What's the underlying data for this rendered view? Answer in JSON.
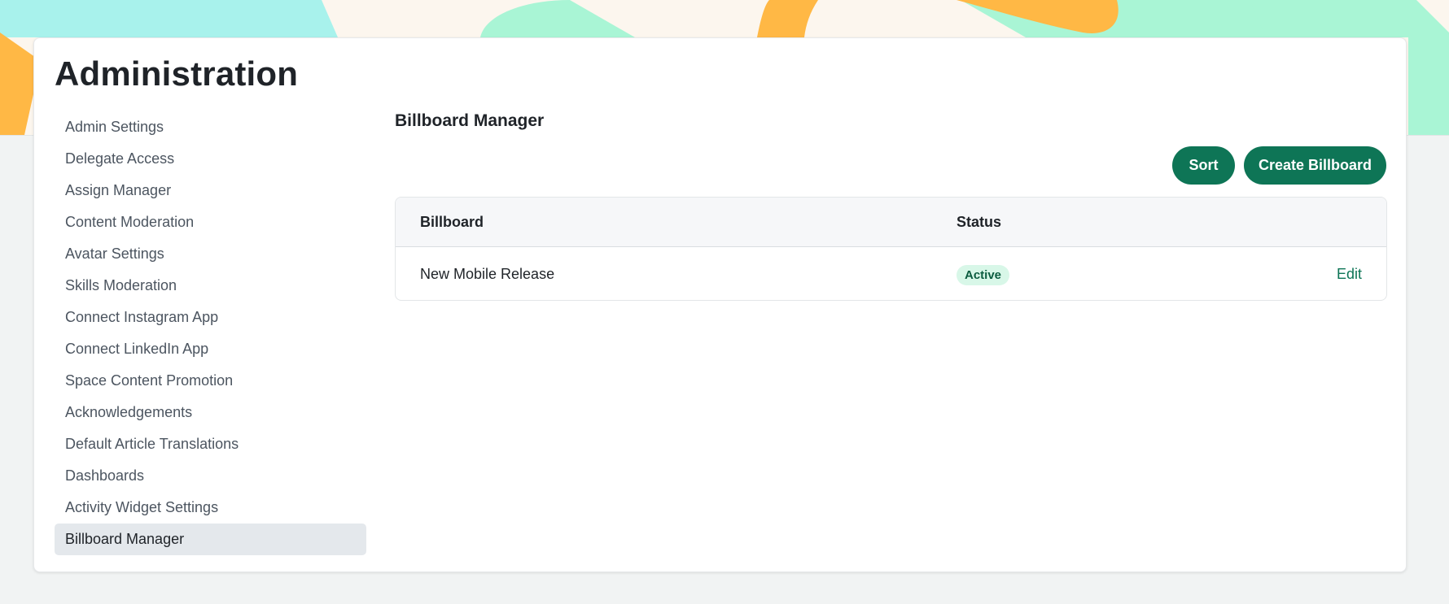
{
  "page": {
    "title": "Administration"
  },
  "sidebar": {
    "items": [
      {
        "label": "Admin Settings"
      },
      {
        "label": "Delegate Access"
      },
      {
        "label": "Assign Manager"
      },
      {
        "label": "Content Moderation"
      },
      {
        "label": "Avatar Settings"
      },
      {
        "label": "Skills Moderation"
      },
      {
        "label": "Connect Instagram App"
      },
      {
        "label": "Connect LinkedIn App"
      },
      {
        "label": "Space Content Promotion"
      },
      {
        "label": "Acknowledgements"
      },
      {
        "label": "Default Article Translations"
      },
      {
        "label": "Dashboards"
      },
      {
        "label": "Activity Widget Settings"
      },
      {
        "label": "Billboard Manager"
      }
    ],
    "active_item": "Billboard Manager"
  },
  "main": {
    "title": "Billboard Manager",
    "actions": {
      "sort_label": "Sort",
      "create_label": "Create Billboard"
    },
    "table": {
      "columns": [
        "Billboard",
        "Status"
      ],
      "rows": [
        {
          "name": "New Mobile Release",
          "status": "Active",
          "action": "Edit"
        }
      ]
    }
  },
  "colors": {
    "accent": "#0e7556",
    "status_active_bg": "#d8f7e8",
    "banner_orange": "#ffb845",
    "banner_green": "#a9f5d5",
    "banner_cyan": "#a8f2ec"
  }
}
